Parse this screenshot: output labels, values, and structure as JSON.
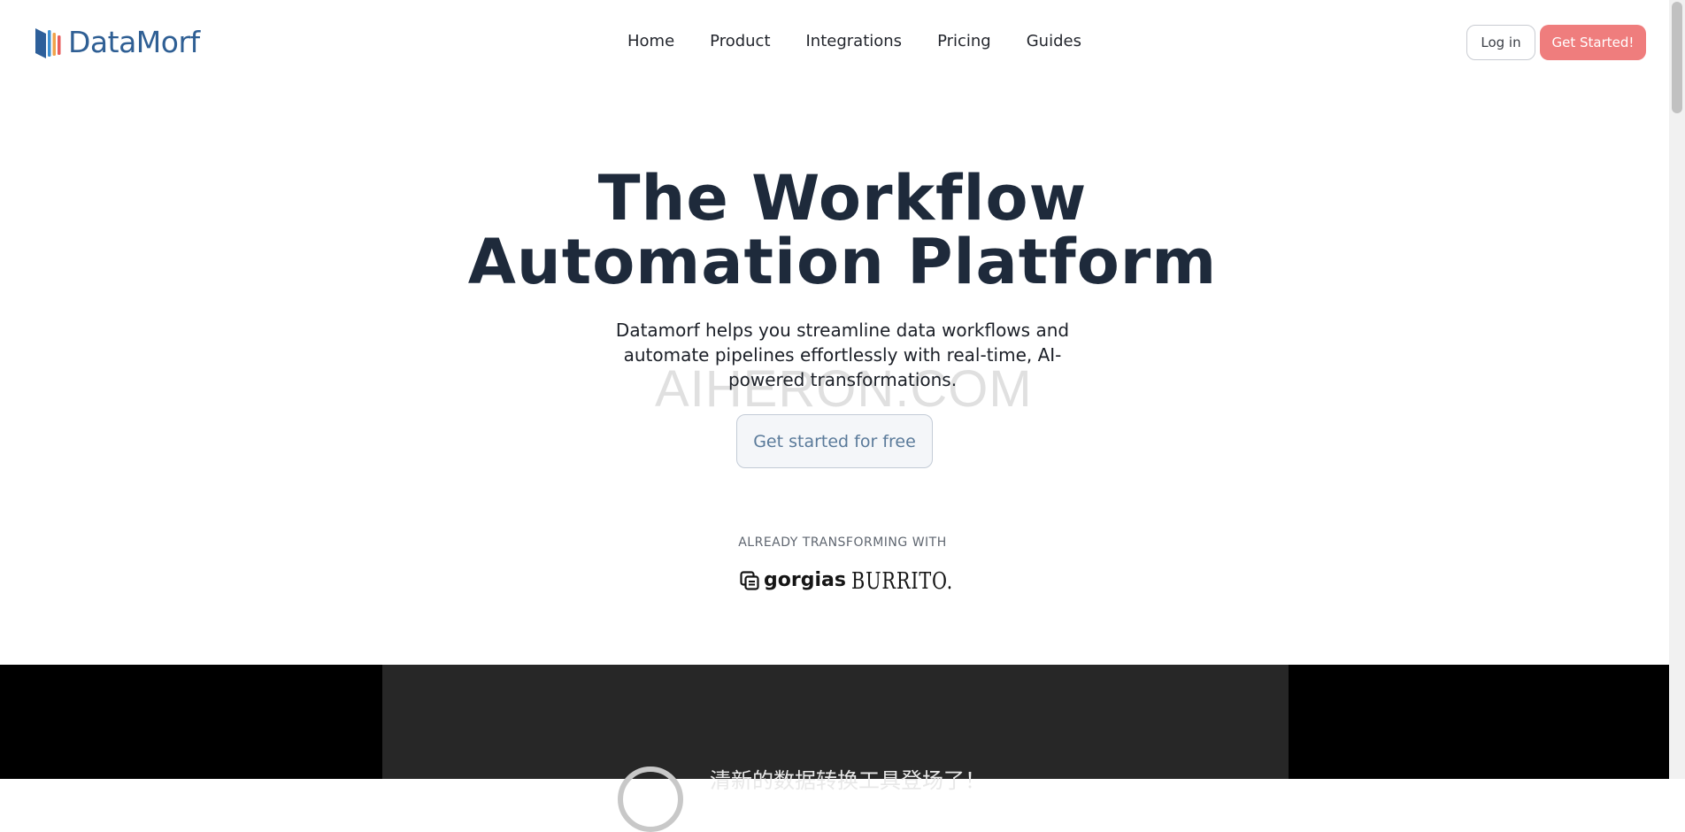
{
  "brand": {
    "name": "DataMorf"
  },
  "nav": {
    "items": [
      {
        "label": "Home"
      },
      {
        "label": "Product"
      },
      {
        "label": "Integrations"
      },
      {
        "label": "Pricing"
      },
      {
        "label": "Guides"
      }
    ],
    "login_label": "Log in",
    "cta_label": "Get Started!"
  },
  "hero": {
    "title_line1": "The Workflow",
    "title_line2": "Automation Platform",
    "subtitle": "Datamorf helps you streamline data workflows and automate pipelines effortlessly with real-time, AI-powered transformations.",
    "watermark": "AIHERON.COM",
    "button_label": "Get started for free"
  },
  "trust": {
    "label": "ALREADY TRANSFORMING WITH",
    "partners": [
      {
        "name": "gorgias",
        "icon": "gorgias-logo-icon"
      },
      {
        "name": "BURRITO."
      }
    ]
  },
  "video": {
    "title": "清新的数据转换工具登场了！"
  },
  "colors": {
    "brand_blue": "#2f5f94",
    "heading": "#1e2a3b",
    "cta": "#ef7d7d",
    "video_bg": "#272727"
  }
}
